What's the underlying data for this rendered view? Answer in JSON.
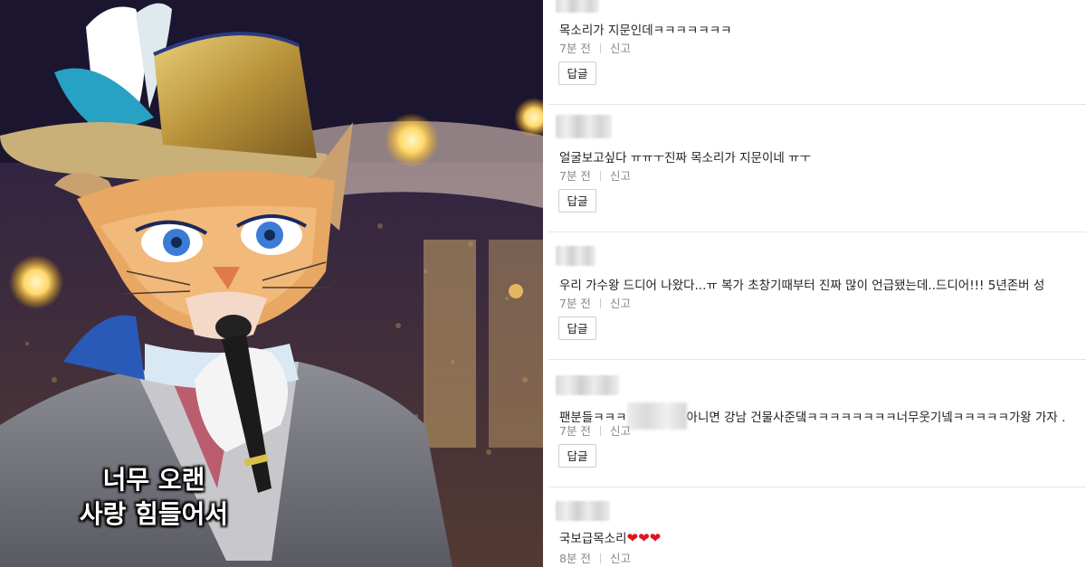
{
  "video": {
    "subtitle_line1": "너무 오랜",
    "subtitle_line2": "사랑 힘들어서"
  },
  "comments": [
    {
      "text": "목소리가 지문인데ㅋㅋㅋㅋㅋㅋㅋ",
      "time": "7분 전",
      "report": "신고",
      "reply": "답글"
    },
    {
      "text": "얼굴보고싶다 ㅠㅠㅜ진짜 목소리가 지문이네 ㅠㅜ",
      "time": "7분 전",
      "report": "신고",
      "reply": "답글"
    },
    {
      "text": "우리 가수왕 드디어 나왔다...ㅠ 복가 초창기때부터 진짜 많이 언급됐는데..드디어!!! 5년존버 성",
      "time": "7분 전",
      "report": "신고",
      "reply": "답글"
    },
    {
      "text_part1": "팬분들ㅋㅋㅋ",
      "text_part2": "아니면 강남 건물사준댘ㅋㅋㅋㅋㅋㅋㅋㅋ너무웃기넼ㅋㅋㅋㅋㅋ가왕 가자 .",
      "time": "7분 전",
      "report": "신고",
      "reply": "답글"
    },
    {
      "text": "국보급목소리",
      "hearts": "❤❤❤",
      "time": "8분 전",
      "report": "신고"
    }
  ],
  "colors": {
    "heart": "#e0141e",
    "meta": "#888888",
    "border": "#e6e6e6"
  }
}
